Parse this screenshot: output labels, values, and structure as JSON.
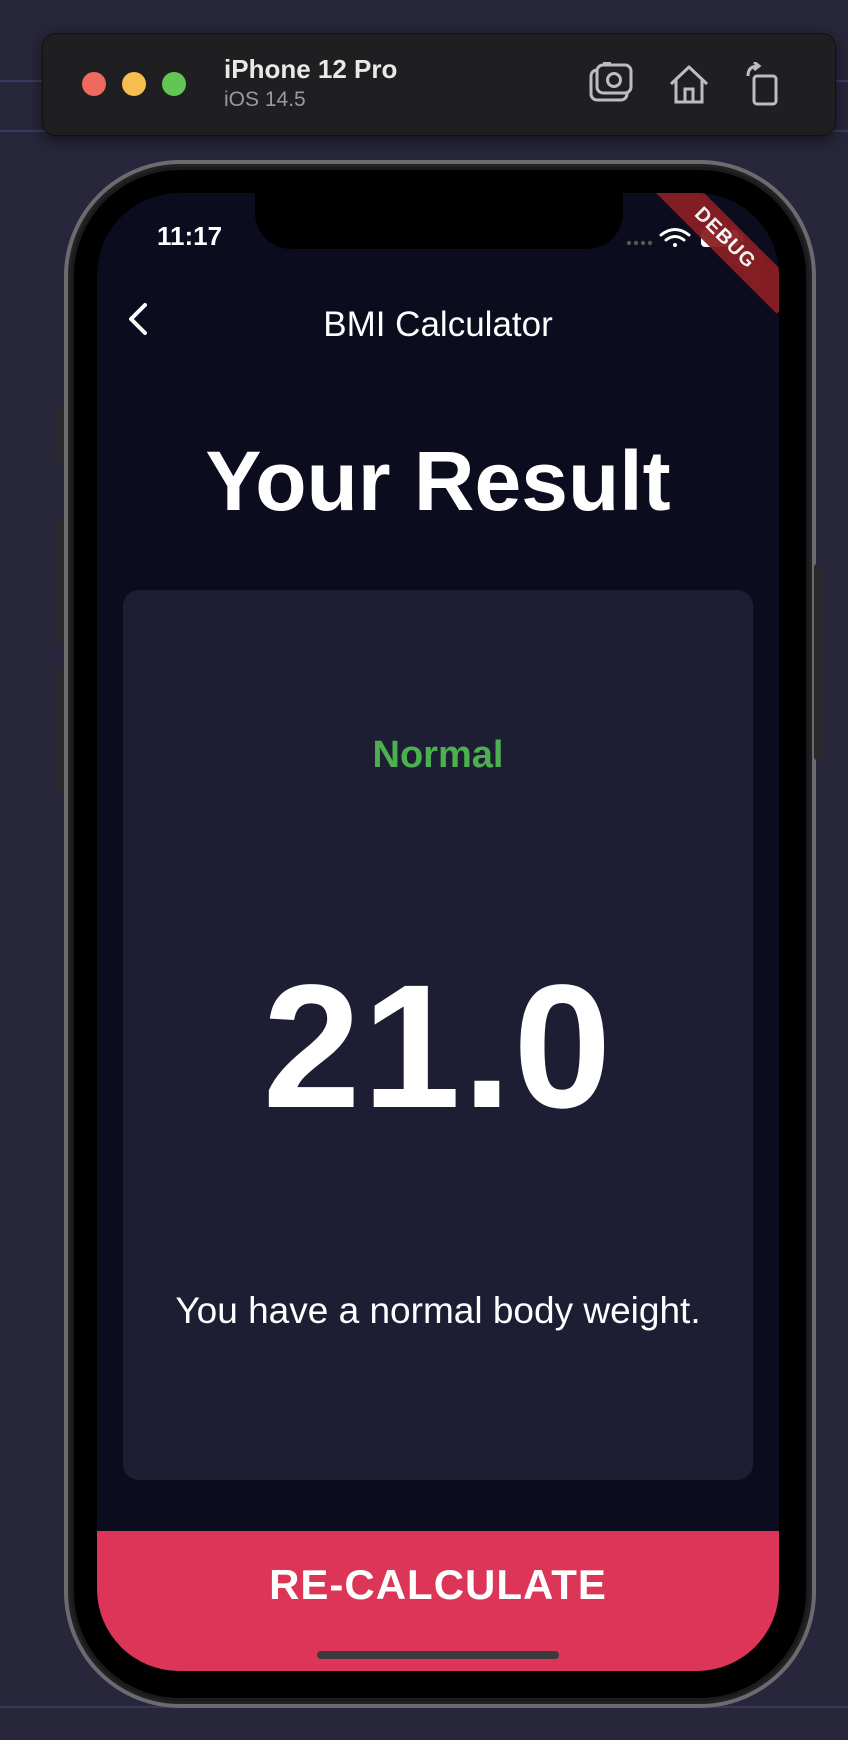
{
  "simulator": {
    "device_name": "iPhone 12 Pro",
    "os_version": "iOS 14.5",
    "buttons": [
      "screenshot-icon",
      "home-icon",
      "rotate-icon"
    ]
  },
  "status_bar": {
    "time": "11:17",
    "debug_banner": "DEBUG"
  },
  "app_bar": {
    "title": "BMI Calculator",
    "back_icon": "chevron-left-icon"
  },
  "result": {
    "heading": "Your Result",
    "status": "Normal",
    "bmi": "21.0",
    "interpretation": "You have a normal body weight."
  },
  "action": {
    "label": "RE-CALCULATE"
  },
  "colors": {
    "background": "#0b0c1e",
    "card": "#1d1e33",
    "status_green": "#4caf50",
    "accent_pink": "#dc3558"
  }
}
